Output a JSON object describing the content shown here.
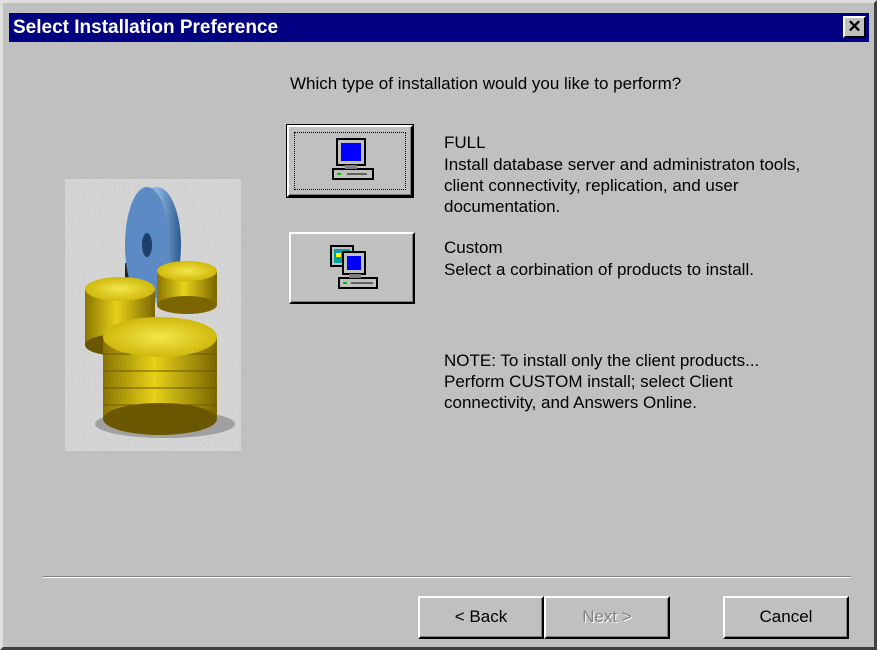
{
  "window": {
    "title": "Select Installation Preference"
  },
  "question": "Which type of installation would you like to perform?",
  "options": [
    {
      "title": "FULL",
      "lines": [
        "Install database server and administraton tools,",
        "client connectivity, replication, and user",
        "documentation."
      ],
      "icon": "computer-icon"
    },
    {
      "title": "Custom",
      "lines": [
        "Select a corbination of products to install."
      ],
      "icon": "custom-computer-icon"
    }
  ],
  "note": [
    "NOTE:  To install only the client products...",
    "Perform CUSTOM install; select Client",
    "connectivity,  and Answers Online."
  ],
  "buttons": {
    "back": "< Back",
    "next": "Next >",
    "cancel": "Cancel"
  },
  "colors": {
    "titlebar": "#000080",
    "face": "#c0c0c0"
  }
}
